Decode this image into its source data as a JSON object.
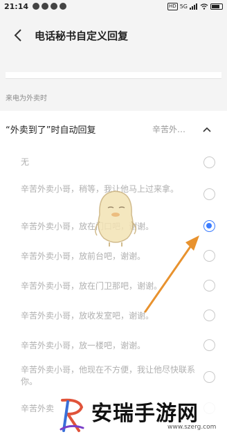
{
  "status_bar": {
    "time": "21:14",
    "network_badge": "HD",
    "signal_label": "5G",
    "battery_label": "battery"
  },
  "header": {
    "back_icon": "back-arrow-icon",
    "title": "电话秘书自定义回复"
  },
  "section": {
    "label": "来电为外卖时"
  },
  "auto_reply": {
    "title": "“外卖到了”时自动回复",
    "value": "辛苦外…",
    "toggle_icon": "chevron-up-icon"
  },
  "options": [
    {
      "text": "无",
      "selected": false
    },
    {
      "text": "辛苦外卖小哥，稍等，我让他马上过来拿。",
      "selected": false
    },
    {
      "text": "辛苦外卖小哥，放在门口吧，谢谢。",
      "selected": true
    },
    {
      "text": "辛苦外卖小哥，放前台吧，谢谢。",
      "selected": false
    },
    {
      "text": "辛苦外卖小哥，放在门卫那吧，谢谢。",
      "selected": false
    },
    {
      "text": "辛苦外卖小哥，放收发室吧，谢谢。",
      "selected": false
    },
    {
      "text": "辛苦外卖小哥，放一楼吧，谢谢。",
      "selected": false
    },
    {
      "text": "辛苦外卖小哥，他现在不方便，我让他尽快联系你。",
      "selected": false
    },
    {
      "text": "辛苦外卖",
      "selected": false
    }
  ],
  "colors": {
    "accent": "#3b7cff",
    "arrow": "#e8922e"
  },
  "watermark": {
    "title": "安瑞手游网",
    "url": "www.szerg.com"
  }
}
